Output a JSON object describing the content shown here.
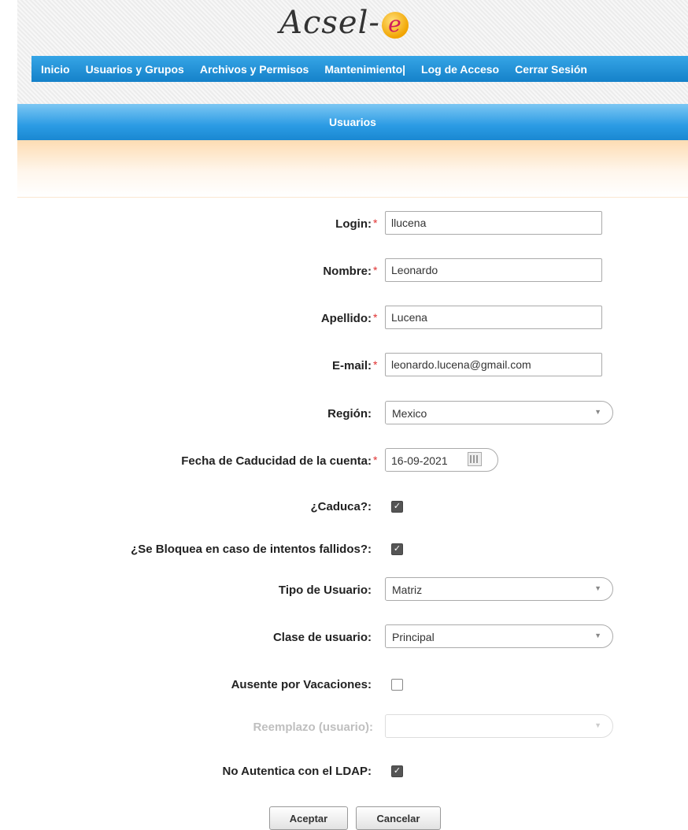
{
  "app": {
    "logo_text": "Acsel-",
    "logo_mark": "e"
  },
  "nav": {
    "items": [
      {
        "label": "Inicio"
      },
      {
        "label": "Usuarios y Grupos"
      },
      {
        "label": "Archivos y Permisos"
      },
      {
        "label": "Mantenimiento|"
      },
      {
        "label": "Log de Acceso"
      },
      {
        "label": "Cerrar Sesión"
      }
    ]
  },
  "page": {
    "title": "Usuarios"
  },
  "form": {
    "login": {
      "label": "Login:",
      "required_mark": "*",
      "value": "llucena"
    },
    "nombre": {
      "label": "Nombre:",
      "required_mark": "*",
      "value": "Leonardo"
    },
    "apellido": {
      "label": "Apellido:",
      "required_mark": "*",
      "value": "Lucena"
    },
    "email": {
      "label": "E-mail:",
      "required_mark": "*",
      "value": "leonardo.lucena@gmail.com"
    },
    "region": {
      "label": "Región:",
      "value": "Mexico"
    },
    "fecha": {
      "label": "Fecha de Caducidad de la cuenta:",
      "required_mark": "*",
      "value": "16-09-2021"
    },
    "caduca": {
      "label": "¿Caduca?:",
      "checked": true
    },
    "bloquea": {
      "label": "¿Se Bloquea en caso de intentos fallidos?:",
      "checked": true
    },
    "tipo": {
      "label": "Tipo de Usuario:",
      "value": "Matriz"
    },
    "clase": {
      "label": "Clase de usuario:",
      "value": "Principal"
    },
    "ausente": {
      "label": "Ausente por Vacaciones:",
      "checked": false
    },
    "reemplazo": {
      "label": "Reemplazo (usuario)",
      "colon": ":",
      "value": ""
    },
    "ldap": {
      "label": "No Autentica con el LDAP:",
      "checked": true
    }
  },
  "buttons": {
    "accept": "Aceptar",
    "cancel": "Cancelar"
  },
  "colors": {
    "nav_blue": "#1581c9",
    "required_red": "#e03030",
    "band_orange": "#fddcb3"
  }
}
